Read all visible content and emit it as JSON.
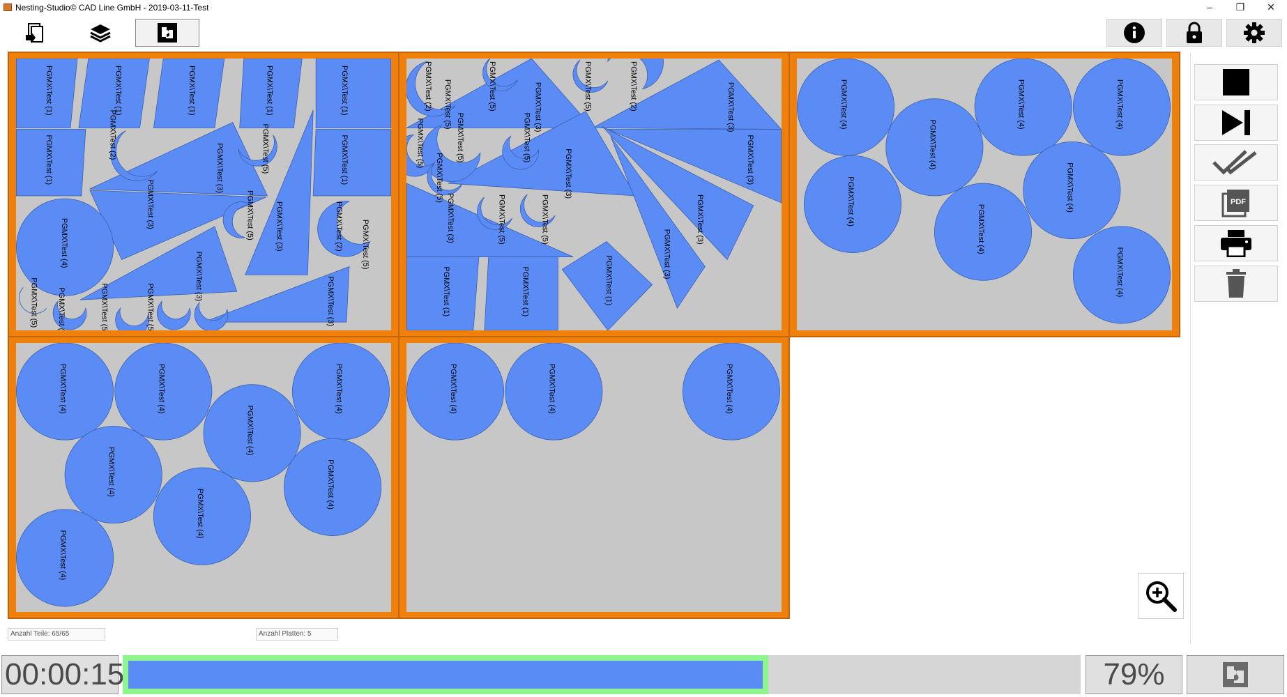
{
  "window": {
    "title": "Nesting-Studio© CAD Line GmbH - 2019-03-11-Test",
    "minimize_glyph": "–",
    "restore_glyph": "❐",
    "close_glyph": "✕"
  },
  "toolbar": {
    "left_buttons": [
      {
        "name": "parts-icon",
        "active": false
      },
      {
        "name": "layers-icon",
        "active": false
      },
      {
        "name": "nesting-icon",
        "active": true
      }
    ],
    "right_buttons": [
      {
        "name": "info-icon"
      },
      {
        "name": "lock-icon"
      },
      {
        "name": "gear-icon"
      }
    ]
  },
  "side_panel": {
    "buttons": [
      {
        "name": "stop-icon"
      },
      {
        "name": "skip-next-icon"
      },
      {
        "name": "double-check-icon"
      },
      {
        "name": "pdf-icon",
        "label": "PDF"
      },
      {
        "name": "printer-icon"
      },
      {
        "name": "trash-icon"
      }
    ]
  },
  "status": {
    "parts_count": "Anzahl Teile: 65/65",
    "plates_count": "Anzahl Platten: 5",
    "elapsed_time": "00:00:15",
    "progress_percent_label": "79%",
    "progress_fraction": 0.79
  },
  "colors": {
    "plate_border": "#f0800c",
    "plate_fill": "#c7c7c7",
    "piece_fill": "#5b8cf5",
    "progress_green": "#8ff58f",
    "progress_blue": "#5a8cf5"
  },
  "labels": {
    "t1": "PGMX\\Test (1)",
    "t2": "PGMX\\Test (2)",
    "t3": "PGMX\\Test (3)",
    "t4": "PGMX\\Test (4)",
    "t5": "PGMX\\Test (5)"
  }
}
